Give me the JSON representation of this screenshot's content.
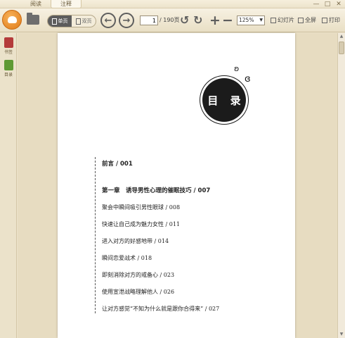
{
  "tabs": [
    {
      "label": "阅读"
    },
    {
      "label": "注释"
    }
  ],
  "window_controls": {
    "minimize": "—",
    "maximize": "□",
    "close": "✕"
  },
  "toolbar": {
    "view_modes": [
      {
        "label": "单页"
      },
      {
        "label": "双页"
      }
    ],
    "prev_icon": "←",
    "next_icon": "→",
    "page_current": "1",
    "page_total": "/ 190页",
    "rotate_left_icon": "↺",
    "rotate_right_icon": "↻",
    "zoom_in_icon": "+",
    "zoom_out_icon": "−",
    "zoom_value": "125%",
    "slideshow_label": "幻灯片",
    "fullscreen_label": "全屏",
    "print_label": "打印"
  },
  "sidebar": {
    "items": [
      {
        "label": "书签",
        "icon": "bookmark-icon"
      },
      {
        "label": "目录",
        "icon": "toc-icon"
      }
    ]
  },
  "page": {
    "toc_title": "目 录",
    "entries": [
      {
        "text": "前言 / 001"
      },
      {
        "text": "第一章　诱导男性心理的催眠技巧 / 007"
      },
      {
        "text": "聚会中瞬间吸引男性眼球 / 008"
      },
      {
        "text": "快速让自己成为魅力女性 / 011"
      },
      {
        "text": "进入对方的好感地带 / 014"
      },
      {
        "text": "瞬间恋爱战术 / 018"
      },
      {
        "text": "即刻消除对方的戒备心 / 023"
      },
      {
        "text": "使用宣泄战略理解他人 / 026"
      },
      {
        "text": "让对方感觉“不知为什么就是跟你合得来” / 027"
      }
    ]
  }
}
